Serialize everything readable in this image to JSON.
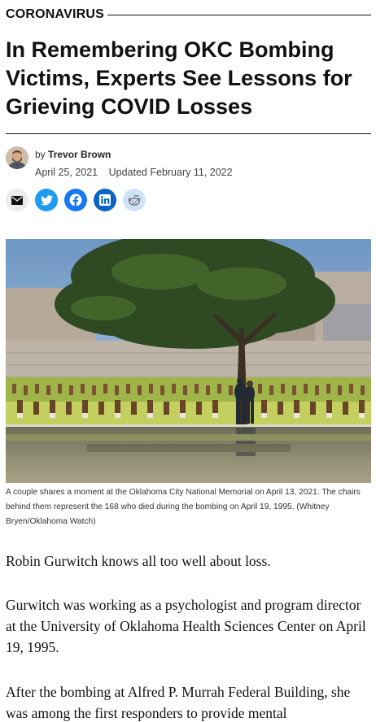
{
  "section": {
    "label": "CORONAVIRUS"
  },
  "headline": "In Remembering OKC Bombing Victims, Experts See Lessons for Grieving COVID Losses",
  "byline": {
    "prefix": "by",
    "author": "Trevor Brown",
    "published": "April 25, 2021",
    "updated": "Updated February 11, 2022"
  },
  "share": {
    "buttons": [
      {
        "name": "email",
        "icon": "envelope-icon",
        "color": "#ececec"
      },
      {
        "name": "twitter",
        "icon": "twitter-bird-icon",
        "color": "#1d9bf0"
      },
      {
        "name": "facebook",
        "icon": "facebook-icon",
        "color": "#1877f2"
      },
      {
        "name": "linkedin",
        "icon": "linkedin-icon",
        "color": "#0a66c2"
      },
      {
        "name": "reddit",
        "icon": "reddit-icon",
        "color": "#cfe3f7"
      }
    ]
  },
  "photo": {
    "caption": "A couple shares a moment at the Oklahoma City National Memorial on April 13, 2021. The chairs behind them represent the 168 who died during the bombing on April 19, 1995. (Whitney Bryen/Oklahoma Watch)"
  },
  "article": {
    "paragraphs": [
      "Robin Gurwitch knows all too well about loss.",
      "Gurwitch was working as a psychologist and program director at the University of Oklahoma Health Sciences Center on April 19, 1995.",
      "After the bombing at Alfred P. Murrah Federal Building, she was among the first responders to provide mental"
    ]
  }
}
